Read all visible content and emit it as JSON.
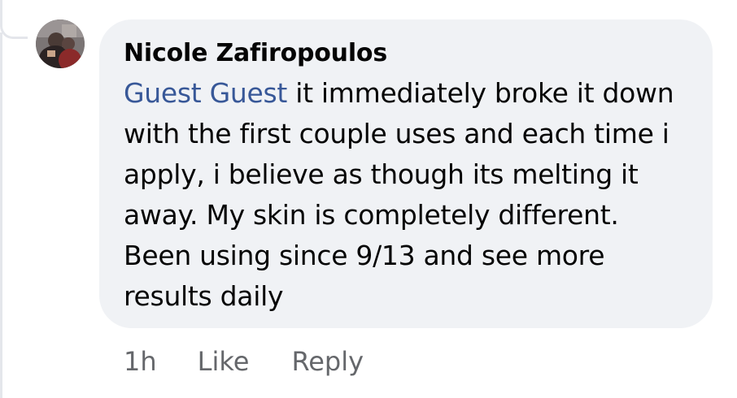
{
  "comment": {
    "author": "Nicole Zafiropoulos",
    "mention": "Guest Guest",
    "text": " it immediately broke it down with the first couple uses and each time i apply, i believe as though its melting it away. My skin is completely different. Been using since 9/13 and see more results daily",
    "timestamp": "1h",
    "like_label": "Like",
    "reply_label": "Reply"
  },
  "avatar_icon": "profile-photo",
  "colors": {
    "bubble": "#f0f2f5",
    "mention": "#385898",
    "meta": "#65676b",
    "text": "#050505"
  }
}
